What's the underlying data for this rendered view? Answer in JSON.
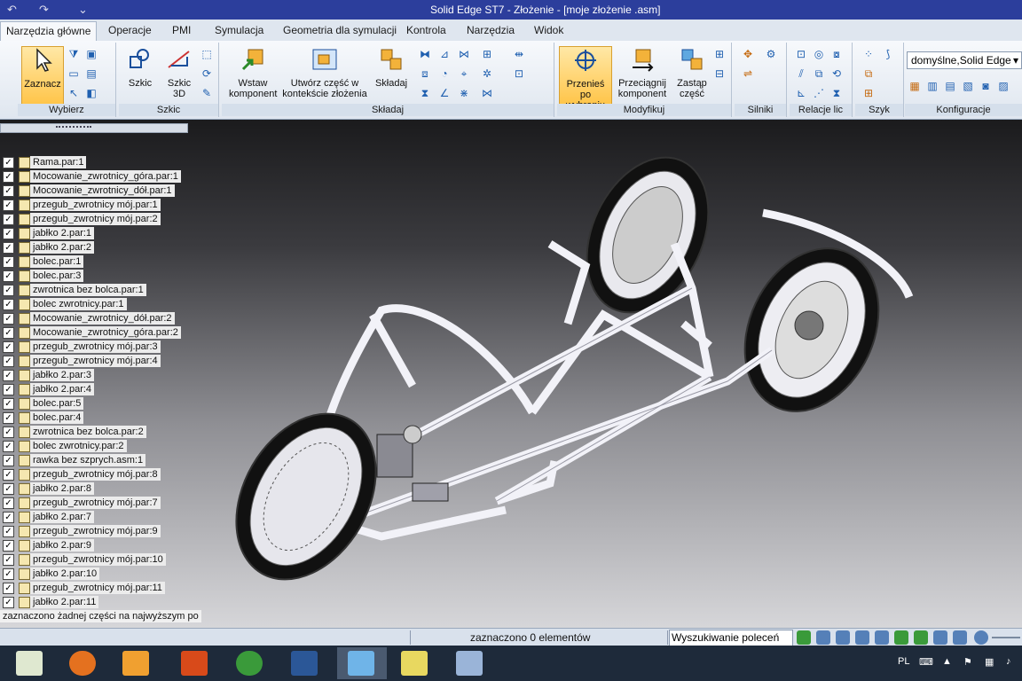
{
  "window": {
    "title": "Solid Edge ST7 - Złożenie - [moje złożenie .asm]"
  },
  "tabs": [
    {
      "label": "Narzędzia główne"
    },
    {
      "label": "Operacje"
    },
    {
      "label": "PMI"
    },
    {
      "label": "Symulacja"
    },
    {
      "label": "Geometria dla symulacji"
    },
    {
      "label": "Kontrola"
    },
    {
      "label": "Narzędzia"
    },
    {
      "label": "Widok"
    }
  ],
  "ribbon": {
    "groups": [
      {
        "label": "Wybierz"
      },
      {
        "label": "Szkic"
      },
      {
        "label": "Składaj"
      },
      {
        "label": "Modyfikuj"
      },
      {
        "label": "Silniki"
      },
      {
        "label": "Relacje lic"
      },
      {
        "label": "Szyk"
      },
      {
        "label": "Konfiguracje"
      }
    ],
    "buttons": {
      "zaznacz": "Zaznacz",
      "szkic": "Szkic",
      "szkic3d_1": "Szkic",
      "szkic3d_2": "3D",
      "wstaw_1": "Wstaw",
      "wstaw_2": "komponent",
      "utworz_1": "Utwórz część w",
      "utworz_2": "kontekście złożenia",
      "skladaj": "Składaj",
      "przenies_1": "Przenieś po",
      "przenies_2": "wybraniu",
      "przeciagnij_1": "Przeciągnij",
      "przeciagnij_2": "komponent",
      "zastap_1": "Zastąp",
      "zastap_2": "część"
    },
    "config_select": "domyślne,Solid Edge"
  },
  "tree": {
    "items": [
      {
        "label": "Rama.par:1"
      },
      {
        "label": "Mocowanie_zwrotnicy_góra.par:1"
      },
      {
        "label": "Mocowanie_zwrotnicy_dół.par:1"
      },
      {
        "label": "przegub_zwrotnicy mój.par:1"
      },
      {
        "label": "przegub_zwrotnicy mój.par:2"
      },
      {
        "label": "jabłko 2.par:1"
      },
      {
        "label": "jabłko 2.par:2"
      },
      {
        "label": "bolec.par:1"
      },
      {
        "label": "bolec.par:3"
      },
      {
        "label": "zwrotnica bez bolca.par:1"
      },
      {
        "label": "bolec zwrotnicy.par:1"
      },
      {
        "label": "Mocowanie_zwrotnicy_dół.par:2"
      },
      {
        "label": "Mocowanie_zwrotnicy_góra.par:2"
      },
      {
        "label": "przegub_zwrotnicy mój.par:3"
      },
      {
        "label": "przegub_zwrotnicy mój.par:4"
      },
      {
        "label": "jabłko 2.par:3"
      },
      {
        "label": "jabłko 2.par:4"
      },
      {
        "label": "bolec.par:5"
      },
      {
        "label": "bolec.par:4"
      },
      {
        "label": "zwrotnica bez bolca.par:2"
      },
      {
        "label": "bolec zwrotnicy.par:2"
      },
      {
        "label": "rawka bez szprych.asm:1"
      },
      {
        "label": "przegub_zwrotnicy mój.par:8"
      },
      {
        "label": "jabłko 2.par:8"
      },
      {
        "label": "przegub_zwrotnicy mój.par:7"
      },
      {
        "label": "jabłko 2.par:7"
      },
      {
        "label": "przegub_zwrotnicy mój.par:9"
      },
      {
        "label": "jabłko 2.par:9"
      },
      {
        "label": "przegub_zwrotnicy mój.par:10"
      },
      {
        "label": "jabłko 2.par:10"
      },
      {
        "label": "przegub_zwrotnicy mój.par:11"
      },
      {
        "label": "jabłko 2.par:11"
      }
    ],
    "status": "zaznaczono żadnej części na najwyższym po"
  },
  "statusbar": {
    "selection": "zaznaczono 0 elementów",
    "command_search": "Wyszukiwanie poleceń"
  },
  "taskbar": {
    "language": "PL"
  }
}
